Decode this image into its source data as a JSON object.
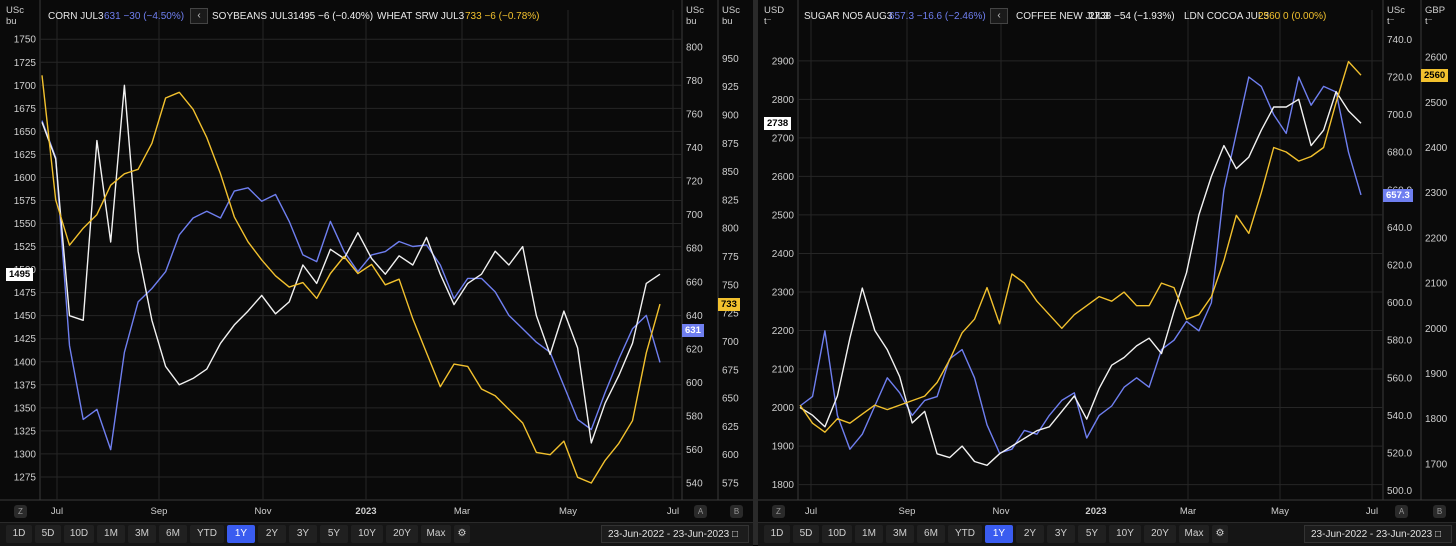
{
  "toolbar": {
    "ranges": [
      "1D",
      "5D",
      "10D",
      "1M",
      "3M",
      "6M",
      "YTD",
      "1Y",
      "2Y",
      "3Y",
      "5Y",
      "10Y",
      "20Y",
      "Max"
    ],
    "active_range": "1Y",
    "date_from": "23-Jun-2022",
    "date_sep": "-",
    "date_to": "23-Jun-2023"
  },
  "colors": {
    "blue": "#6f7ff0",
    "white": "#f2f2f2",
    "yellow": "#f2c12e",
    "grid": "#262626"
  },
  "chart_data": [
    {
      "type": "line",
      "x_ticks": [
        "Jul",
        "Sep",
        "Nov",
        "2023",
        "Mar",
        "May",
        "Jul"
      ],
      "x_range": [
        "2022-06-23",
        "2023-06-23"
      ],
      "units": {
        "left": "USc\nbu",
        "right1": "USc\nbu",
        "right2": "USc\nbu"
      },
      "axes": {
        "left": {
          "range": [
            1250,
            1760
          ],
          "ticks": [
            1275,
            1300,
            1325,
            1350,
            1375,
            1400,
            1425,
            1450,
            1475,
            1500,
            1525,
            1550,
            1575,
            1600,
            1625,
            1650,
            1675,
            1700,
            1725,
            1750
          ]
        },
        "right1": {
          "range": [
            530,
            810
          ],
          "ticks": [
            540,
            560,
            580,
            600,
            620,
            640,
            660,
            680,
            700,
            720,
            740,
            760,
            780,
            800
          ]
        },
        "right2": {
          "range": [
            560,
            975
          ],
          "ticks": [
            575,
            600,
            625,
            650,
            675,
            700,
            725,
            750,
            775,
            800,
            825,
            850,
            875,
            900,
            925,
            950
          ]
        }
      },
      "series": [
        {
          "name": "CORN JUL3",
          "last": "631",
          "change": "−30 (−4.50%)",
          "color": "blue",
          "axis": "right1",
          "values": [
            756,
            734,
            622,
            578,
            584,
            560,
            618,
            648,
            656,
            666,
            688,
            698,
            702,
            698,
            714,
            716,
            708,
            712,
            696,
            676,
            672,
            696,
            678,
            666,
            676,
            678,
            684,
            681,
            682,
            670,
            650,
            662,
            662,
            654,
            640,
            632,
            624,
            618,
            598,
            578,
            572,
            594,
            614,
            632,
            640,
            612
          ]
        },
        {
          "name": "SOYBEANS JUL3",
          "last": "1495",
          "change": "−6 (−0.40%)",
          "color": "white",
          "axis": "left",
          "values": [
            1660,
            1620,
            1450,
            1445,
            1640,
            1530,
            1700,
            1520,
            1445,
            1395,
            1375,
            1382,
            1392,
            1420,
            1440,
            1455,
            1472,
            1452,
            1465,
            1505,
            1485,
            1522,
            1512,
            1540,
            1512,
            1495,
            1515,
            1505,
            1535,
            1495,
            1462,
            1485,
            1495,
            1520,
            1505,
            1525,
            1450,
            1408,
            1455,
            1415,
            1312,
            1355,
            1385,
            1420,
            1485,
            1495
          ]
        },
        {
          "name": "WHEAT SRW JUL3",
          "last": "733",
          "change": "−6 (−0.78%)",
          "color": "yellow",
          "axis": "right2",
          "values": [
            935,
            825,
            785,
            800,
            812,
            838,
            848,
            852,
            875,
            915,
            920,
            905,
            880,
            848,
            810,
            788,
            772,
            758,
            748,
            752,
            738,
            760,
            775,
            760,
            768,
            750,
            755,
            720,
            690,
            660,
            680,
            678,
            658,
            652,
            640,
            628,
            602,
            600,
            612,
            580,
            575,
            595,
            610,
            630,
            690,
            733
          ]
        }
      ],
      "pills": {
        "left": "1495",
        "right1": "631",
        "right2": "733"
      },
      "buttons": {
        "left_badge": "Z",
        "r1_badge": "A",
        "r2_badge": "B",
        "nav": "‹"
      }
    },
    {
      "type": "line",
      "x_ticks": [
        "Jul",
        "Sep",
        "Nov",
        "2023",
        "Mar",
        "May",
        "Jul"
      ],
      "x_range": [
        "2022-06-23",
        "2023-06-23"
      ],
      "units": {
        "left": "USD\nt⁻",
        "right1": "USc\nt⁻",
        "right2": "GBP\nt⁻"
      },
      "axes": {
        "left": {
          "range": [
            1760,
            2980
          ],
          "ticks": [
            1800,
            1900,
            2000,
            2100,
            2200,
            2300,
            2400,
            2500,
            2600,
            2700,
            2800,
            2900
          ]
        },
        "right1": {
          "range": [
            495,
            745
          ],
          "ticks": [
            "500.0",
            "520.0",
            "540.0",
            "560.0",
            "580.0",
            "600.0",
            "620.0",
            "640.0",
            "660.0",
            "680.0",
            "700.0",
            "720.0",
            "740.0"
          ]
        },
        "right2": {
          "range": [
            1620,
            2660
          ],
          "ticks": [
            1700,
            1800,
            1900,
            2000,
            2100,
            2200,
            2300,
            2400,
            2500,
            2600
          ]
        }
      },
      "series": [
        {
          "name": "SUGAR NO5 AUG3",
          "last": "657.3",
          "change": "−16.6 (−2.46%)",
          "color": "blue",
          "axis": "right1",
          "values": [
            545,
            550,
            585,
            540,
            522,
            530,
            545,
            560,
            552,
            540,
            548,
            550,
            570,
            575,
            560,
            535,
            520,
            522,
            532,
            530,
            540,
            548,
            552,
            528,
            540,
            545,
            555,
            560,
            555,
            575,
            580,
            590,
            585,
            600,
            660,
            690,
            720,
            715,
            700,
            690,
            720,
            705,
            715,
            712,
            680,
            657.3
          ]
        },
        {
          "name": "COFFEE NEW JUL3",
          "last": "2738",
          "change": "−54 (−1.93%)",
          "color": "white",
          "axis": "left",
          "values": [
            2000,
            1980,
            1950,
            2030,
            2180,
            2310,
            2200,
            2150,
            2080,
            1960,
            1990,
            1880,
            1870,
            1900,
            1860,
            1850,
            1880,
            1900,
            1920,
            1940,
            1950,
            1990,
            2030,
            1970,
            2050,
            2110,
            2130,
            2160,
            2180,
            2140,
            2250,
            2350,
            2500,
            2600,
            2680,
            2620,
            2650,
            2720,
            2780,
            2780,
            2800,
            2680,
            2720,
            2820,
            2770,
            2738
          ]
        },
        {
          "name": "LDN COCOA JUL3",
          "last": "2560",
          "change": "0 (0.00%)",
          "color": "yellow",
          "axis": "right2",
          "values": [
            1830,
            1790,
            1770,
            1800,
            1790,
            1810,
            1830,
            1820,
            1830,
            1840,
            1850,
            1880,
            1930,
            1990,
            2020,
            2090,
            2010,
            2120,
            2100,
            2060,
            2030,
            2000,
            2030,
            2050,
            2070,
            2060,
            2080,
            2050,
            2050,
            2100,
            2090,
            2020,
            2030,
            2070,
            2150,
            2250,
            2210,
            2300,
            2400,
            2390,
            2370,
            2380,
            2400,
            2500,
            2590,
            2560
          ]
        }
      ],
      "pills": {
        "left": "2738",
        "right1": "657.3",
        "right2": "2560"
      },
      "buttons": {
        "left_badge": "Z",
        "r1_badge": "A",
        "r2_badge": "B",
        "nav": "‹"
      }
    }
  ]
}
